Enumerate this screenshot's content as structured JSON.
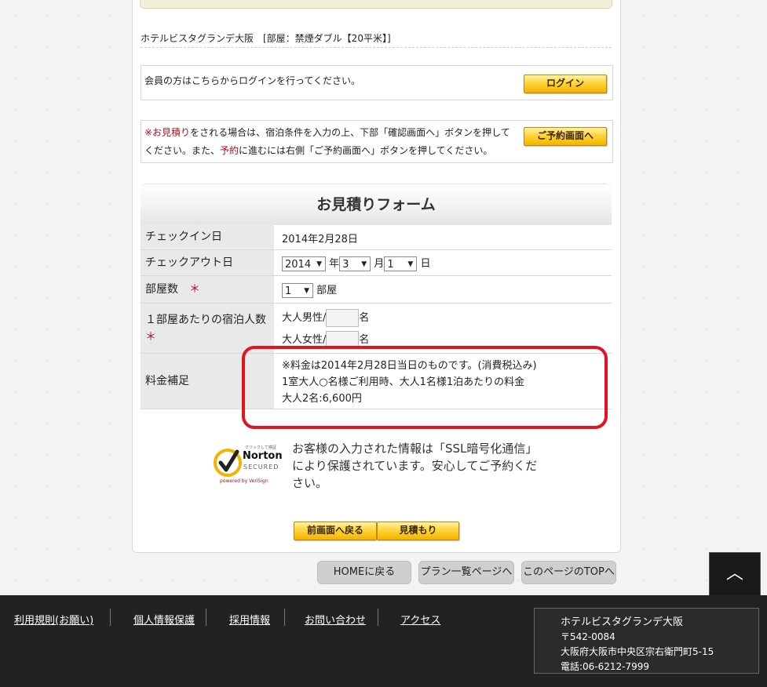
{
  "hotel_line": "ホテルビスタグランデ大阪　[部屋：禁煙ダブル【20平米】]",
  "login_box": {
    "message": "会員の方はこちらからログインを行ってください。",
    "button": "ログイン"
  },
  "notice_box": {
    "prefix_red": "※お見積り",
    "text1": "をされる場合は、宿泊条件を入力の上、下部「確認画面へ」ボタンを押してください。また、",
    "link_red": "予約",
    "text2": "に進むには右側「ご予約画面へ」ボタンを押してください。",
    "button": "ご予約画面へ"
  },
  "form": {
    "title": "お見積りフォーム",
    "checkin_label": "チェックイン日",
    "checkin_value": "2014年2月28日",
    "checkout_label": "チェックアウト日",
    "checkout_year": "2014",
    "year_unit": "年",
    "checkout_month": "3",
    "month_unit": "月",
    "checkout_day": "1",
    "day_unit": "日",
    "rooms_label": "部屋数",
    "required_mark": "＊",
    "rooms_value": "1",
    "rooms_unit": "部屋",
    "guests_label": "１部屋あたりの宿泊人数",
    "male_label": "大人男性/",
    "female_label": "大人女性/",
    "person_unit": "名",
    "fee_label": "料金補足",
    "fee_line1": "※料金は2014年2月28日当日のものです。(消費税込み)",
    "fee_line2": "1室大人○名様ご利用時、大人1名様1泊あたりの料金",
    "fee_line3": "大人2名:6,600円"
  },
  "norton": {
    "top_small": "クリックして検証",
    "brand": "Norton",
    "secured": "SECURED",
    "powered": "powered by VeriSign"
  },
  "ssl_text": "お客様の入力された情報は「SSL暗号化通信」により保護されています。安心してご予約ください。",
  "buttons": {
    "back": "前画面へ戻る",
    "quote": "見積もり",
    "home": "HOMEに戻る",
    "plans": "プラン一覧ページへ",
    "page_top": "このページのTOPへ",
    "up_arrow": "︿"
  },
  "footer": {
    "links": [
      "利用規則(お願い)",
      "個人情報保護",
      "採用情報",
      "お問い合わせ",
      "アクセス"
    ],
    "address": {
      "name": "ホテルビスタグランデ大阪",
      "zip": "〒542-0084",
      "addr": "大阪府大阪市中央区宗右衛門町5-15",
      "tel": "電話:06-6212-7999"
    }
  },
  "colors": {
    "accent_red": "#a0141e",
    "highlight_circle": "#e3141f",
    "button_gold": "#ffd43b",
    "footer_bg": "#222222"
  }
}
